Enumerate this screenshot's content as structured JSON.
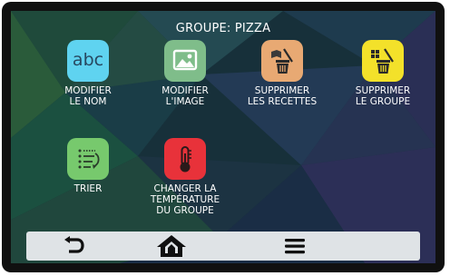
{
  "header": {
    "title": "GROUPE: PIZZA"
  },
  "tiles": [
    {
      "label": "MODIFIER\nLE NOM",
      "icon": "text-abc-icon",
      "color": "#5fd3f0",
      "glyph": "abc"
    },
    {
      "label": "MODIFIER\nL'IMAGE",
      "icon": "image-icon",
      "color": "#7fbd8a"
    },
    {
      "label": "SUPPRIMER\nLES RECETTES",
      "icon": "trash-recipes-icon",
      "color": "#e8a973"
    },
    {
      "label": "SUPPRIMER\nLE GROUPE",
      "icon": "trash-group-icon",
      "color": "#f3e12a"
    },
    {
      "label": "TRIER",
      "icon": "sort-list-icon",
      "color": "#77c96d"
    },
    {
      "label": "CHANGER LA\nTEMPÉRATURE\nDU GROUPE",
      "icon": "thermometer-icon",
      "color": "#e8323a"
    }
  ],
  "nav": {
    "back": "back-icon",
    "home": "home-icon",
    "menu": "menu-icon"
  }
}
